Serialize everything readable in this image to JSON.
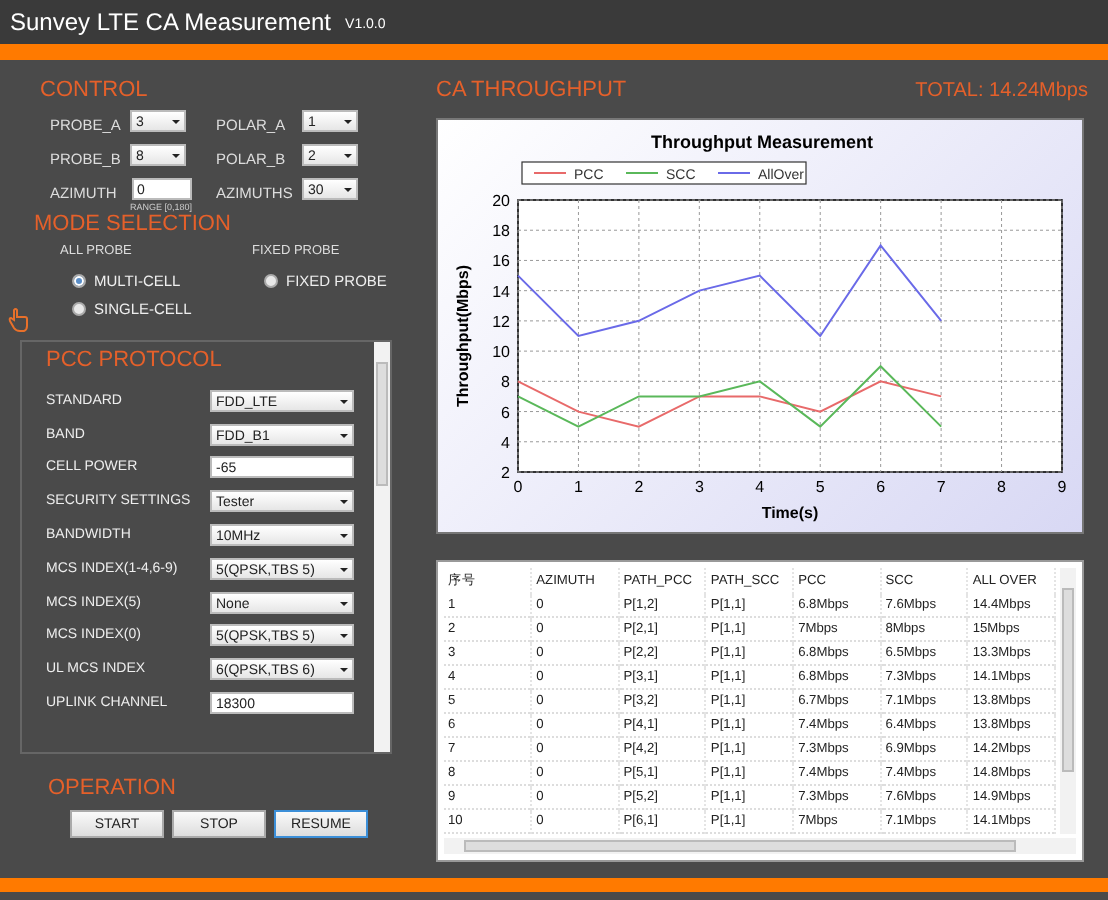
{
  "window": {
    "title": "Sunvey LTE CA Measurement",
    "version": "V1.0.0"
  },
  "control": {
    "heading": "CONTROL",
    "fields": [
      {
        "label": "PROBE_A",
        "kind": "select",
        "value": "3"
      },
      {
        "label": "POLAR_A",
        "kind": "select",
        "value": "1"
      },
      {
        "label": "PROBE_B",
        "kind": "select",
        "value": "8"
      },
      {
        "label": "POLAR_B",
        "kind": "select",
        "value": "2"
      },
      {
        "label": "AZIMUTH",
        "kind": "input",
        "value": "0",
        "hint": "RANGE [0,180]"
      },
      {
        "label": "AZIMUTHS",
        "kind": "select",
        "value": "30"
      }
    ]
  },
  "mode_selection": {
    "heading": "MODE SELECTION",
    "groups": [
      {
        "title": "ALL PROBE",
        "options": [
          {
            "label": "MULTI-CELL",
            "selected": true
          },
          {
            "label": "SINGLE-CELL",
            "selected": false
          }
        ]
      },
      {
        "title": "FIXED PROBE",
        "options": [
          {
            "label": "FIXED PROBE",
            "selected": false
          }
        ]
      }
    ]
  },
  "pcc_protocol": {
    "heading": "PCC PROTOCOL",
    "fields": [
      {
        "label": "STANDARD",
        "kind": "select",
        "value": "FDD_LTE"
      },
      {
        "label": "BAND",
        "kind": "select",
        "value": "FDD_B1"
      },
      {
        "label": "CELL POWER",
        "kind": "input",
        "value": "-65"
      },
      {
        "label": "SECURITY SETTINGS",
        "kind": "select",
        "value": "Tester"
      },
      {
        "label": "BANDWIDTH",
        "kind": "select",
        "value": "10MHz"
      },
      {
        "label": "MCS INDEX(1-4,6-9)",
        "kind": "select",
        "value": "5(QPSK,TBS 5)"
      },
      {
        "label": "MCS INDEX(5)",
        "kind": "select",
        "value": "None"
      },
      {
        "label": "MCS INDEX(0)",
        "kind": "select",
        "value": "5(QPSK,TBS 5)"
      },
      {
        "label": "UL MCS INDEX",
        "kind": "select",
        "value": "6(QPSK,TBS 6)"
      },
      {
        "label": "UPLINK CHANNEL",
        "kind": "input",
        "value": "18300"
      }
    ]
  },
  "operation": {
    "heading": "OPERATION",
    "buttons": [
      {
        "label": "START",
        "focused": false
      },
      {
        "label": "STOP",
        "focused": false
      },
      {
        "label": "RESUME",
        "focused": true
      }
    ]
  },
  "throughput": {
    "heading": "CA THROUGHPUT",
    "total": "TOTAL: 14.24Mbps",
    "chart_data": {
      "type": "line",
      "grid": true,
      "legend": true,
      "title": "Throughput Measurement",
      "xlabel": "Time(s)",
      "ylabel": "Throughput(Mbps)",
      "x": [
        0,
        1,
        2,
        3,
        4,
        5,
        6,
        7
      ],
      "xlim": [
        0,
        9
      ],
      "ylim": [
        2,
        20
      ],
      "xticks": [
        0,
        1,
        2,
        3,
        4,
        5,
        6,
        7,
        8,
        9
      ],
      "yticks": [
        2,
        4,
        6,
        8,
        10,
        12,
        14,
        16,
        18,
        20
      ],
      "series": [
        {
          "name": "PCC",
          "color": "#e86a6a",
          "values": [
            8,
            6,
            5,
            7,
            7,
            6,
            8,
            7
          ]
        },
        {
          "name": "SCC",
          "color": "#5ab85a",
          "values": [
            7,
            5,
            7,
            7,
            8,
            5,
            9,
            5
          ]
        },
        {
          "name": "AllOver",
          "color": "#6a6ae8",
          "values": [
            15,
            11,
            12,
            14,
            15,
            11,
            17,
            12
          ]
        }
      ]
    }
  },
  "table": {
    "columns": [
      "序号",
      "AZIMUTH",
      "PATH_PCC",
      "PATH_SCC",
      "PCC",
      "SCC",
      "ALL OVER"
    ],
    "rows": [
      [
        "1",
        "0",
        "P[1,2]",
        "P[1,1]",
        "6.8Mbps",
        "7.6Mbps",
        "14.4Mbps"
      ],
      [
        "2",
        "0",
        "P[2,1]",
        "P[1,1]",
        "7Mbps",
        "8Mbps",
        "15Mbps"
      ],
      [
        "3",
        "0",
        "P[2,2]",
        "P[1,1]",
        "6.8Mbps",
        "6.5Mbps",
        "13.3Mbps"
      ],
      [
        "4",
        "0",
        "P[3,1]",
        "P[1,1]",
        "6.8Mbps",
        "7.3Mbps",
        "14.1Mbps"
      ],
      [
        "5",
        "0",
        "P[3,2]",
        "P[1,1]",
        "6.7Mbps",
        "7.1Mbps",
        "13.8Mbps"
      ],
      [
        "6",
        "0",
        "P[4,1]",
        "P[1,1]",
        "7.4Mbps",
        "6.4Mbps",
        "13.8Mbps"
      ],
      [
        "7",
        "0",
        "P[4,2]",
        "P[1,1]",
        "7.3Mbps",
        "6.9Mbps",
        "14.2Mbps"
      ],
      [
        "8",
        "0",
        "P[5,1]",
        "P[1,1]",
        "7.4Mbps",
        "7.4Mbps",
        "14.8Mbps"
      ],
      [
        "9",
        "0",
        "P[5,2]",
        "P[1,1]",
        "7.3Mbps",
        "7.6Mbps",
        "14.9Mbps"
      ],
      [
        "10",
        "0",
        "P[6,1]",
        "P[1,1]",
        "7Mbps",
        "7.1Mbps",
        "14.1Mbps"
      ]
    ]
  }
}
